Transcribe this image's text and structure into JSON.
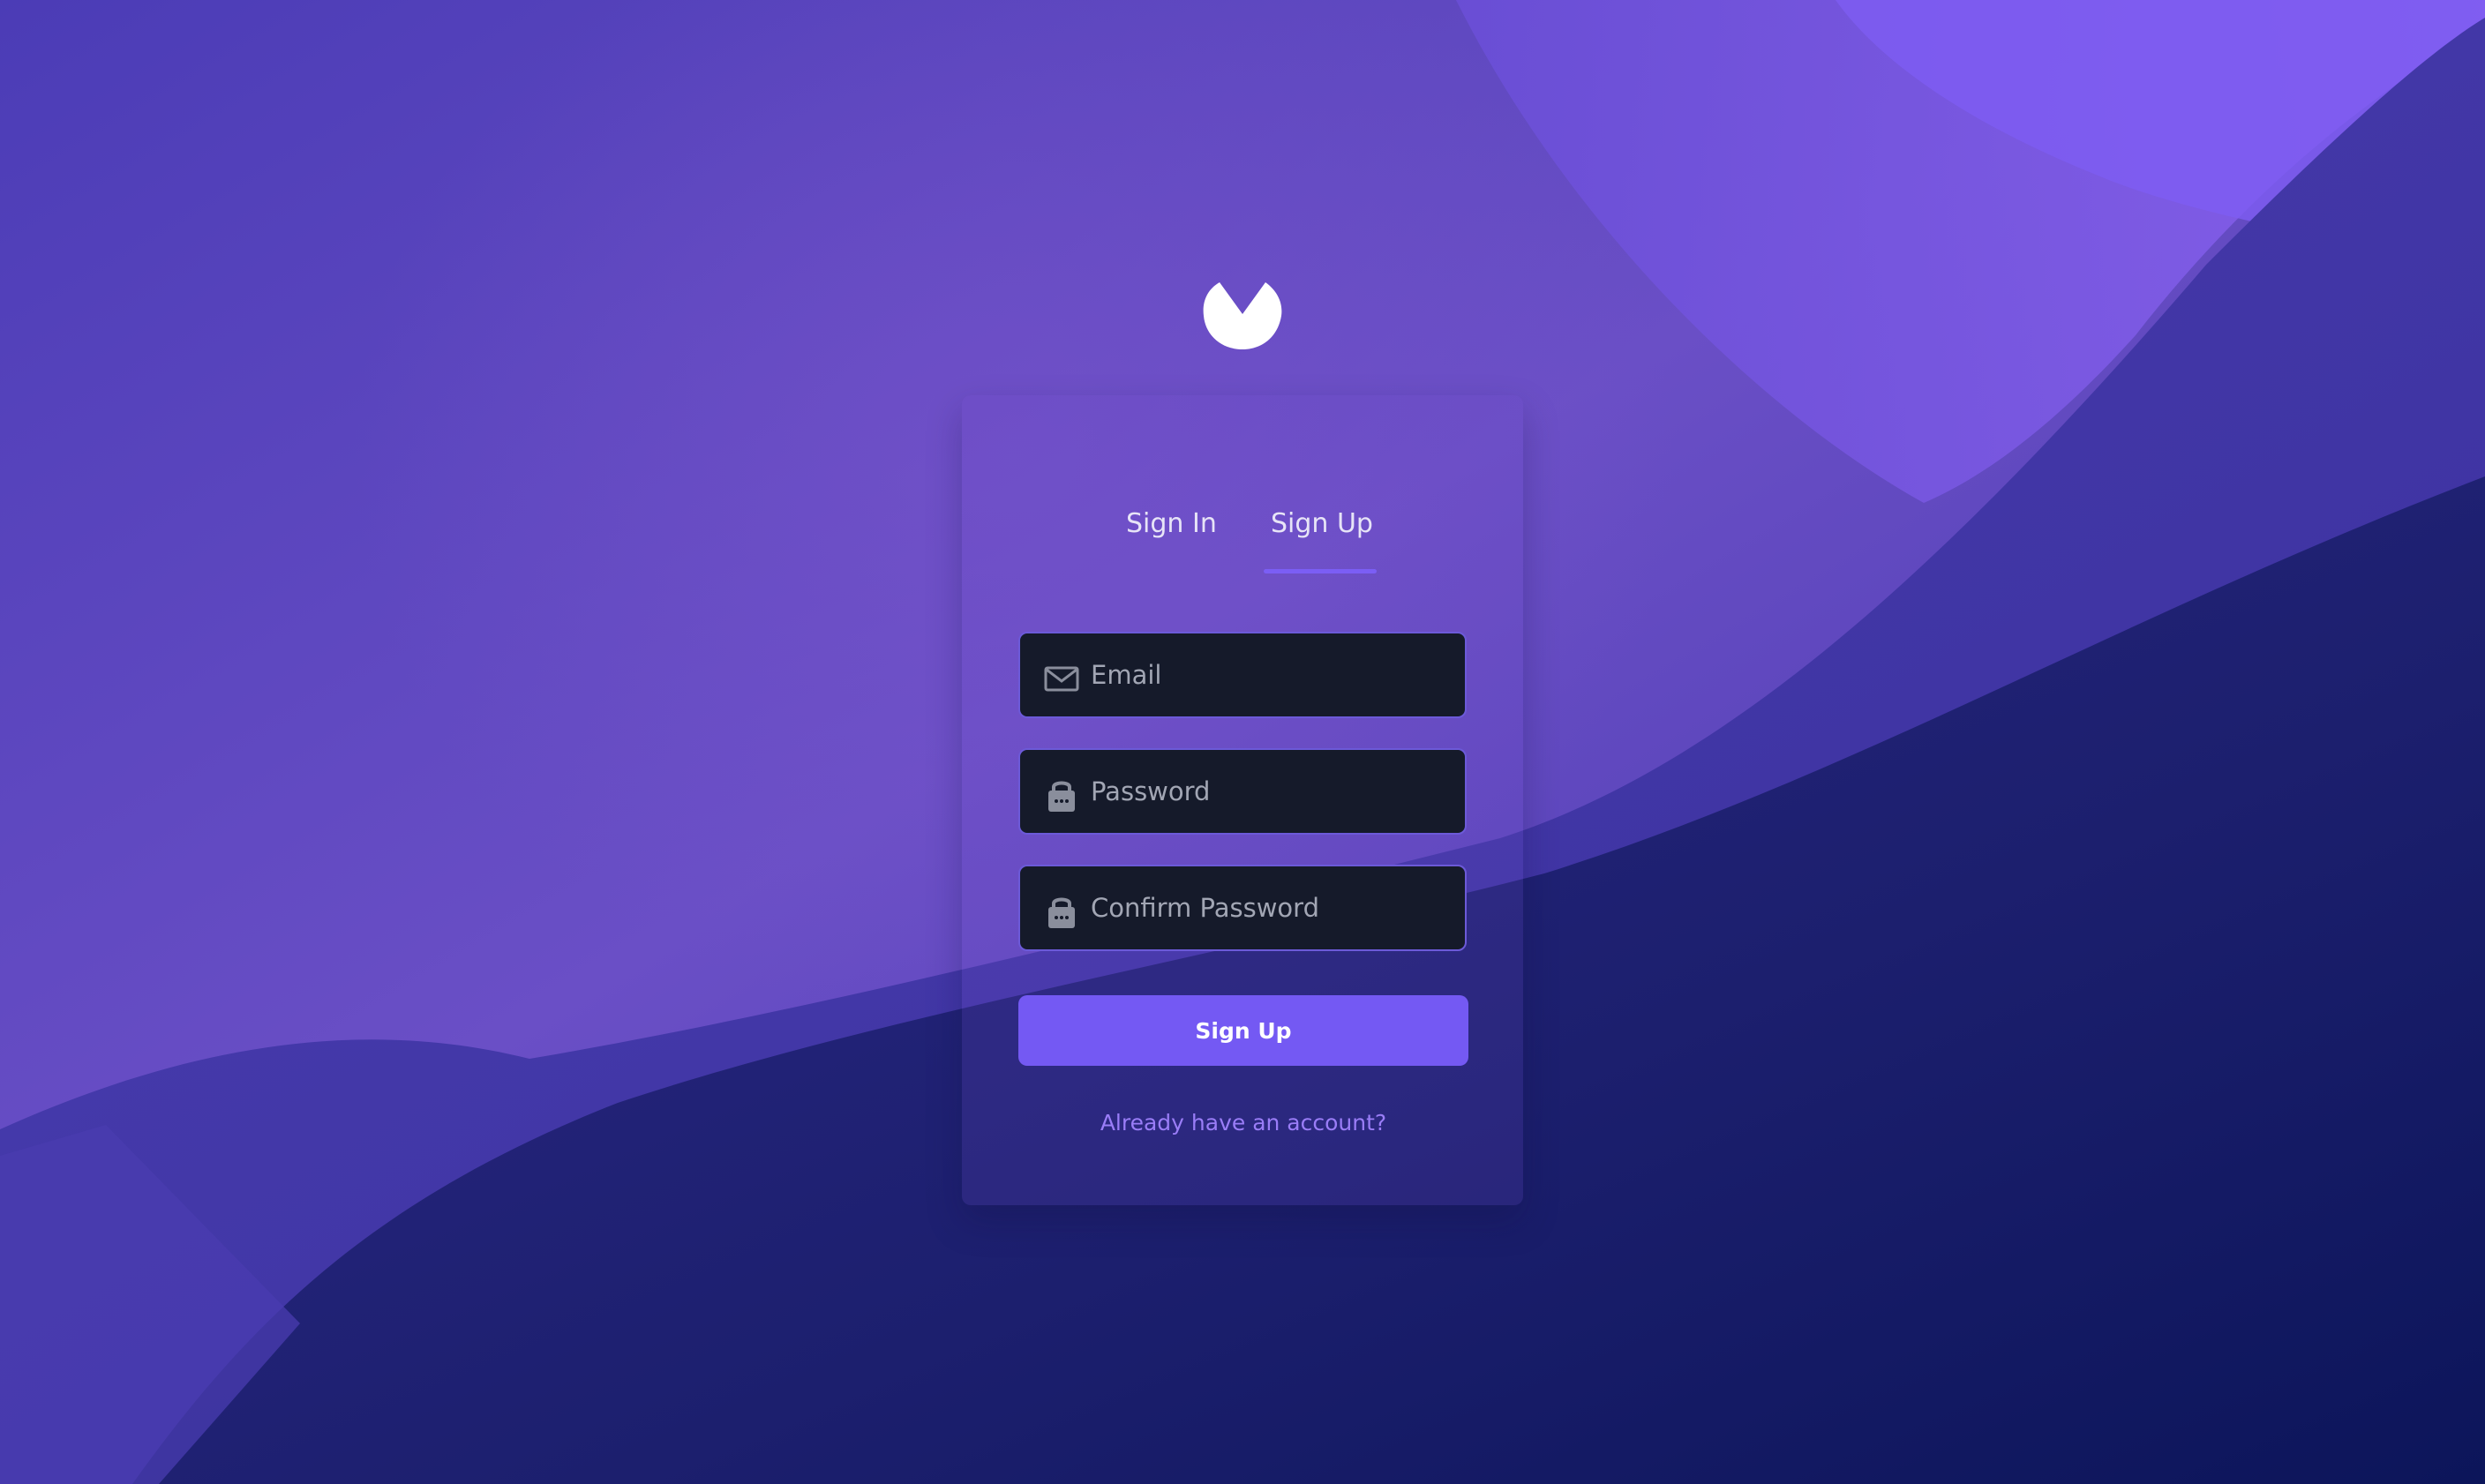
{
  "app": {
    "logo_icon": "brand-logo-icon"
  },
  "tabs": [
    {
      "label": "Sign In",
      "active": false
    },
    {
      "label": "Sign Up",
      "active": true
    }
  ],
  "form": {
    "email": {
      "placeholder": "Email",
      "value": "",
      "icon": "mail-icon"
    },
    "password": {
      "placeholder": "Password",
      "value": "",
      "icon": "lock-icon"
    },
    "confirm_password": {
      "placeholder": "Confirm Password",
      "value": "",
      "icon": "lock-icon"
    },
    "submit_label": "Sign Up",
    "account_link": "Already have an account?"
  },
  "colors": {
    "accent": "#7459f3",
    "link": "#9a7df7",
    "field_bg": "#151a2a",
    "field_border": "#6c5ad8"
  }
}
